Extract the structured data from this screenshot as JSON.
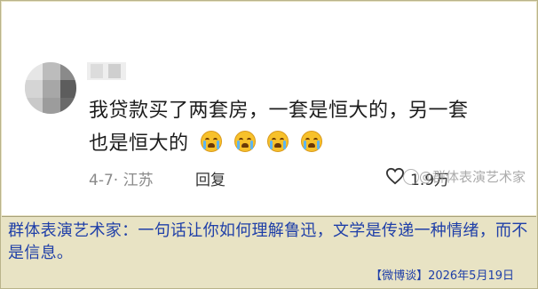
{
  "post": {
    "comment_line1": "我贷款买了两套房，一套是恒大的，另一套",
    "comment_line2": "也是恒大的",
    "emoji": "crying-face-icon",
    "date_location": "4-7· 江苏",
    "reply_label": "回复",
    "like_count": "1.9万",
    "watermark": "@群体表演艺术家"
  },
  "caption": {
    "text": "群体表演艺术家：一句话让你如何理解鲁迅，文学是传递一种情绪，而不是信息。",
    "footer": "【微博谈】2026年5月19日"
  },
  "colors": {
    "caption_text": "#1f3fa8",
    "background": "#e8e3c4",
    "emoji": "#f7c12b"
  }
}
